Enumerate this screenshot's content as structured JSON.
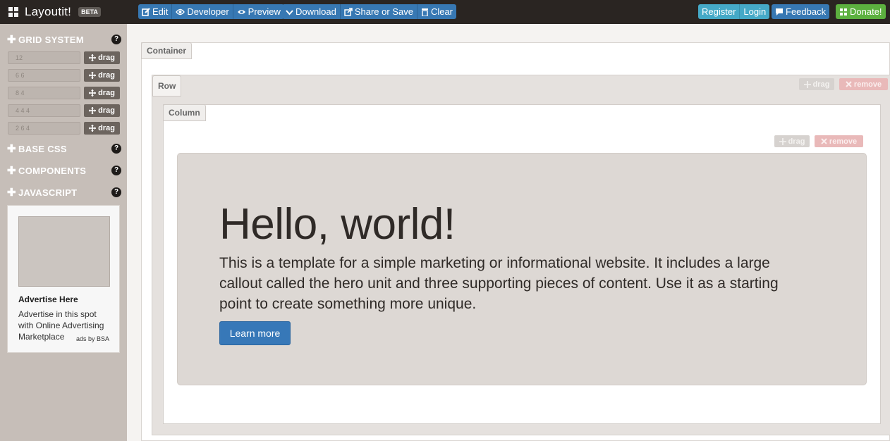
{
  "app": {
    "title": "Layoutit!",
    "badge": "BETA"
  },
  "toolbar": {
    "edit": "Edit",
    "developer": "Developer",
    "preview": "Preview",
    "download": "Download",
    "share": "Share or Save",
    "clear": "Clear",
    "register": "Register",
    "login": "Login",
    "feedback": "Feedback",
    "donate": "Donate!"
  },
  "sidebar": {
    "grid_system": "GRID SYSTEM",
    "help": "?",
    "grid_rows": [
      {
        "value": "12",
        "drag": "drag"
      },
      {
        "value": "6 6",
        "drag": "drag"
      },
      {
        "value": "8 4",
        "drag": "drag"
      },
      {
        "value": "4 4 4",
        "drag": "drag"
      },
      {
        "value": "2 6 4",
        "drag": "drag"
      }
    ],
    "base_css": "BASE CSS",
    "components": "COMPONENTS",
    "javascript": "JAVASCRIPT",
    "plus": "✚",
    "ad": {
      "title": "Advertise Here",
      "text": "Advertise in this spot with Online Advertising Marketplace",
      "by": "ads by BSA"
    }
  },
  "canvas": {
    "container_label": "Container",
    "row_label": "Row",
    "column_label": "Column",
    "drag": "drag",
    "remove": "remove",
    "hero": {
      "title": "Hello, world!",
      "text": "This is a template for a simple marketing or informational website. It includes a large callout called the hero unit and three supporting pieces of content. Use it as a starting point to create something more unique.",
      "button": "Learn more"
    }
  },
  "colors": {
    "topbar": "#2a2522",
    "primary": "#3778b3",
    "info": "#45a9c7",
    "success": "#5cb03f",
    "sidebar": "#c6beb8"
  },
  "icons": [
    "grid-logo-icon",
    "edit-icon",
    "developer-icon",
    "eye-icon",
    "download-icon",
    "share-icon",
    "trash-icon",
    "comment-icon",
    "gift-icon",
    "move-icon",
    "close-icon",
    "help-icon",
    "plus-icon"
  ]
}
